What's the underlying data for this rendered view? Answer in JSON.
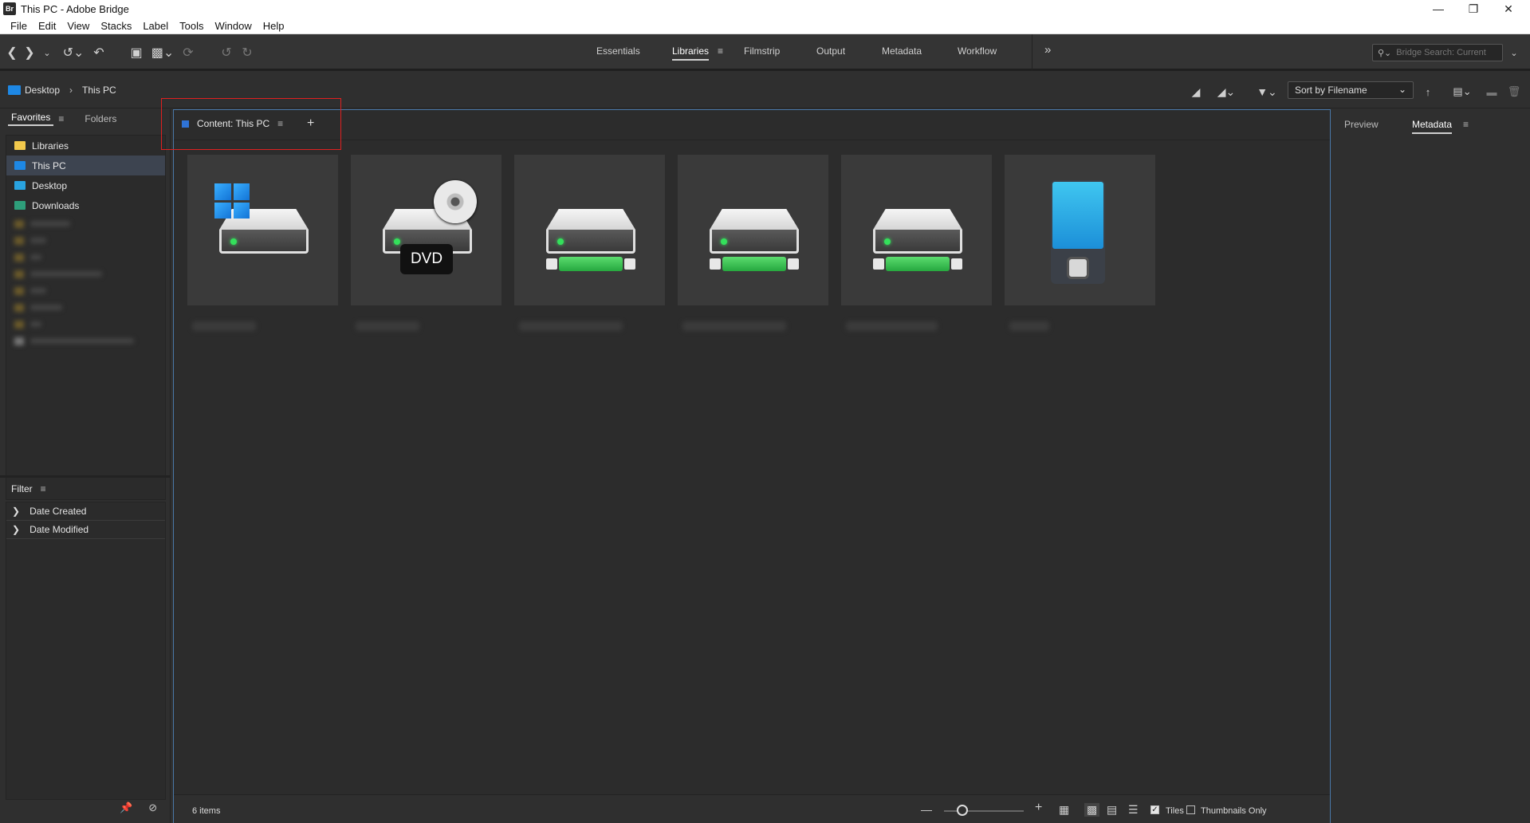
{
  "window": {
    "title": "This PC - Adobe Bridge",
    "app_icon": "Br",
    "controls": [
      "minimize-icon",
      "restore-icon",
      "close-icon"
    ]
  },
  "menubar": {
    "items": [
      "File",
      "Edit",
      "View",
      "Stacks",
      "Label",
      "Tools",
      "Window",
      "Help"
    ]
  },
  "toolbar": {
    "workspaces": [
      "Essentials",
      "Libraries",
      "Filmstrip",
      "Output",
      "Metadata",
      "Workflow"
    ],
    "active_workspace": "Libraries",
    "overflow_glyph": "»",
    "search_placeholder": "Bridge Search: Current"
  },
  "pathbar": {
    "breadcrumb": [
      "Desktop",
      "This PC"
    ],
    "sort_label": "Sort by Filename"
  },
  "left_panel": {
    "tabs": [
      "Favorites",
      "Folders"
    ],
    "favorites": [
      {
        "label": "Libraries",
        "icon": "folder-icon",
        "color": "#f2c94c"
      },
      {
        "label": "This PC",
        "icon": "computer-icon",
        "color": "#1e88e5"
      },
      {
        "label": "Desktop",
        "icon": "desktop-icon",
        "color": "#29a3e0"
      },
      {
        "label": "Downloads",
        "icon": "downloads-icon",
        "color": "#2e9e7a"
      }
    ],
    "filter_title": "Filter",
    "filters": [
      "Date Created",
      "Date Modified"
    ]
  },
  "content": {
    "tab_label": "Content: This PC",
    "add_tab_glyph": "+",
    "item_count": "6 items",
    "tiles": [
      {
        "kind": "windows-drive"
      },
      {
        "kind": "dvd-drive",
        "badge": "DVD"
      },
      {
        "kind": "removable-drive"
      },
      {
        "kind": "removable-drive"
      },
      {
        "kind": "removable-drive"
      },
      {
        "kind": "phone-device"
      }
    ],
    "footer": {
      "tiles_label": "Tiles",
      "tiles_checked": true,
      "thumbnails_only_label": "Thumbnails Only",
      "thumbnails_only_checked": false
    }
  },
  "right_panel": {
    "tabs": [
      "Preview",
      "Metadata"
    ],
    "active_tab": "Metadata"
  },
  "colors": {
    "accent_blue": "#2f73d6",
    "panel_bg": "#2f2f2f",
    "highlight_red": "#e02020"
  }
}
